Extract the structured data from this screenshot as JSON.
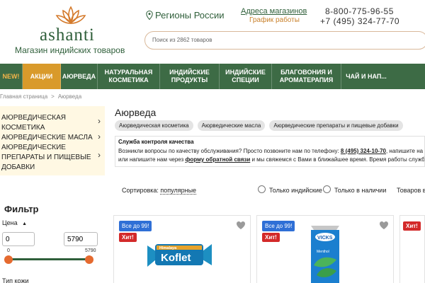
{
  "header": {
    "logo_text": "ashanti",
    "tagline": "Магазин индийских товаров",
    "region": "Регионы России",
    "stores_link": "Адреса магазинов",
    "schedule_link": "График работы",
    "phone1": "8-800-775-96-55",
    "phone2": "+7 (495) 324-77-70",
    "search_placeholder": "Поиск из 2862 товаров"
  },
  "nav": {
    "items": [
      "NEW!",
      "АКЦИИ",
      "АЮРВЕДА",
      "НАТУРАЛЬНАЯ КОСМЕТИКА",
      "ИНДИЙСКИЕ ПРОДУКТЫ",
      "ИНДИЙСКИЕ СПЕЦИИ",
      "БЛАГОВОНИЯ И АРОМАТЕРАПИЯ",
      "ЧАЙ И НАП..."
    ]
  },
  "breadcrumb": {
    "home": "Главная страница",
    "sep": ">",
    "current": "Аюрведа"
  },
  "sidebar": {
    "categories": [
      "АЮРВЕДИЧЕСКАЯ КОСМЕТИКА",
      "АЮРВЕДИЧЕСКИЕ МАСЛА",
      "АЮРВЕДИЧЕСКИЕ ПРЕПАРАТЫ И ПИЩЕВЫЕ ДОБАВКИ"
    ],
    "arrow": "›"
  },
  "filter": {
    "title": "Фильтр",
    "price_label": "Цена",
    "price_min": "0",
    "price_max": "5790",
    "slider_min": "0",
    "slider_max": "5790",
    "type_label": "Тип кожи"
  },
  "main": {
    "title": "Аюрведа",
    "tags": [
      "Аюрведическая косметика",
      "Аюрведические масла",
      "Аюрведические препараты и пищевые добавки"
    ]
  },
  "notice": {
    "title": "Служба контроля качества",
    "line1_pre": "Возникли вопросы по качеству обслуживания? Просто позвоните нам по телефону: ",
    "line1_phone": "8 (495) 324-10-70",
    "line1_post": ", напишите на п",
    "line2_pre": "или напишите нам через ",
    "line2_link": "форму обратной связи",
    "line2_post": " и мы свяжемся с Вами в ближайшее время. Время работы службы: ПН"
  },
  "sortbar": {
    "label": "Сортировка:",
    "value": "популярные",
    "opt1": "Только индийские",
    "opt2": "Только в наличии",
    "count": "Товаров в"
  },
  "products": [
    {
      "badge": "Все до 99!",
      "hit": "Хит!",
      "brand": "Himalaya",
      "name": "Koflet"
    },
    {
      "badge": "Все до 99!",
      "hit": "Хит!",
      "brand": "VICKS",
      "name": "Menthol"
    },
    {
      "hit": "Хит!"
    }
  ],
  "colors": {
    "brand_green": "#3d6b45",
    "accent_orange": "#d99a2b",
    "badge_blue": "#2f6fd6",
    "hit_red": "#d32a2a",
    "slider_knob": "#e56a2f",
    "category_bg": "#fff8e3"
  }
}
